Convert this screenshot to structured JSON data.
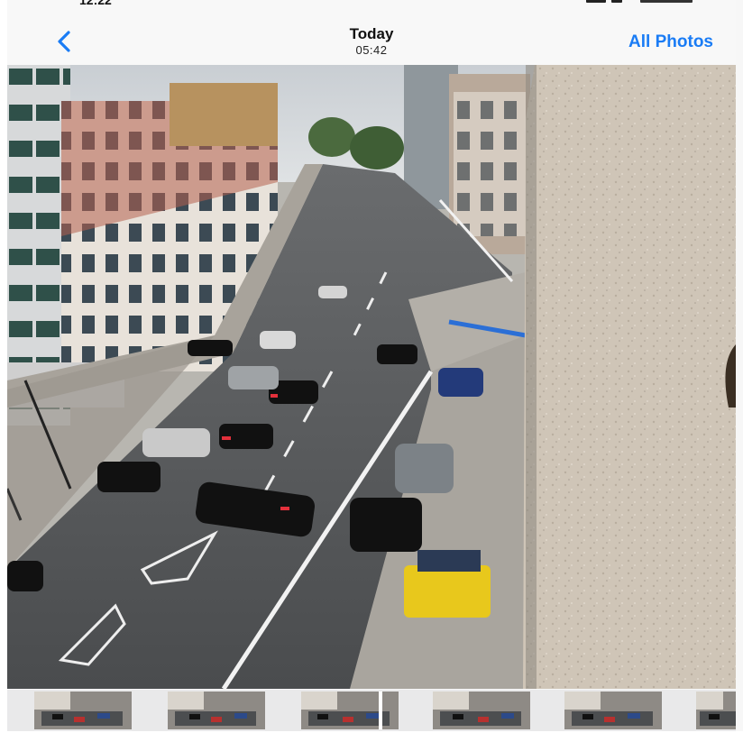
{
  "status_bar": {
    "time": "12:22"
  },
  "nav": {
    "back_icon": "chevron-left-icon",
    "title": "Today",
    "subtitle": "05:42",
    "all_photos_label": "All Photos",
    "accent_color": "#1a7cf5"
  },
  "photo": {
    "description_icon": "street-photo"
  },
  "thumbnails": {
    "count": 6
  }
}
